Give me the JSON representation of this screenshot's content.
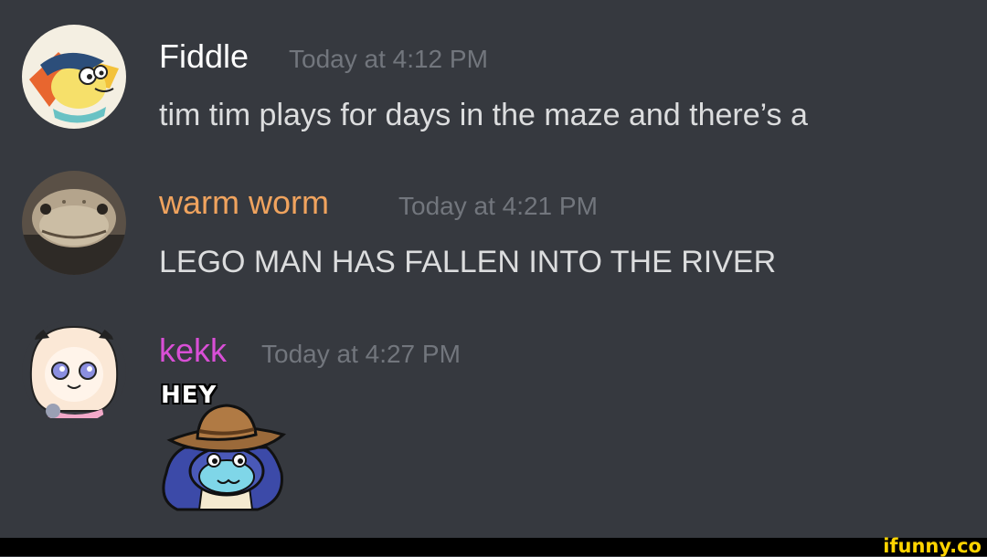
{
  "messages": [
    {
      "username": "Fiddle",
      "username_color": "#ffffff",
      "timestamp": "Today at 4:12 PM",
      "text": "tim tim plays for days in the maze and there’s a"
    },
    {
      "username": "warm worm",
      "username_color": "#f0a35e",
      "timestamp": "Today at 4:21 PM",
      "text": "LEGO MAN HAS FALLEN INTO THE RIVER"
    },
    {
      "username": "kekk",
      "username_color": "#d94fd6",
      "timestamp": "Today at 4:27 PM",
      "sticker_text": "HEY"
    }
  ],
  "watermark": "ifunny.co",
  "colors": {
    "background": "#36393f",
    "timestamp": "#72767d",
    "message_text": "#dcddde",
    "watermark": "#ffd400"
  }
}
